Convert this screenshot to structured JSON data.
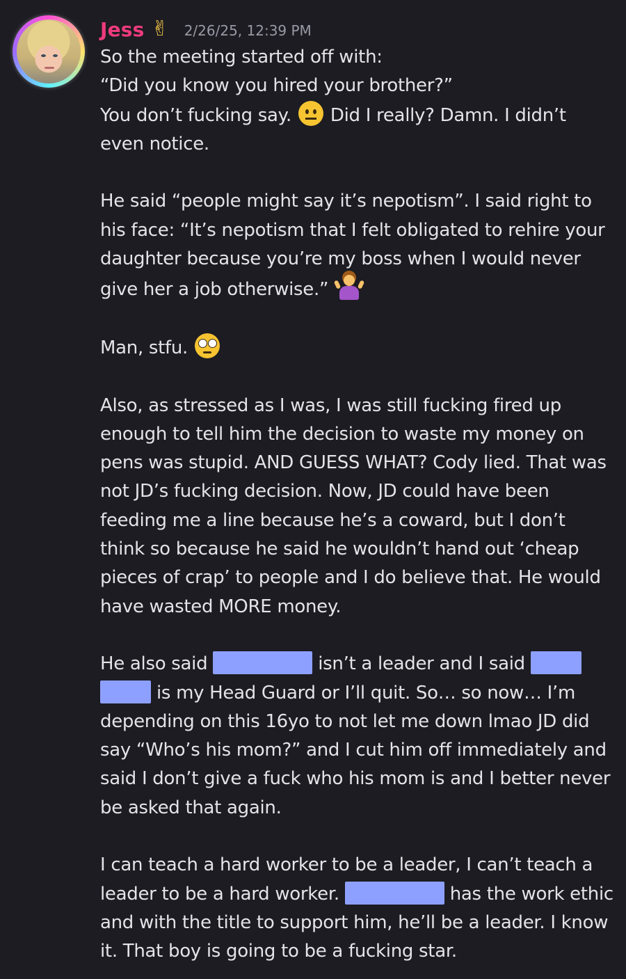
{
  "message": {
    "author": "Jess",
    "role_icon": "victory-hand-emoji",
    "timestamp": "2/26/25, 12:39 PM",
    "avatar_icon": "user-avatar",
    "paragraphs": {
      "p1": {
        "l1": "So the meeting started off with:",
        "l2": "“Did you know you hired your brother?”",
        "l3a": "You don’t fucking say. ",
        "l3b": " Did I really? Damn. I didn’t even notice."
      },
      "p2": {
        "text": "He said “people might say it’s nepotism”. I said right to his face: “It’s nepotism that I felt obligated to rehire your daughter because you’re my boss when I would never give her a job otherwise.” "
      },
      "p3": {
        "text": "Man, stfu. "
      },
      "p4": {
        "text": "Also, as stressed as I was, I was still fucking fired up enough to tell him the decision to waste my money on pens was stupid. AND GUESS WHAT? Cody lied. That was not JD’s fucking decision. Now, JD could have been feeding me a line because he’s a coward, but I don’t think so because he said he wouldn’t hand out ‘cheap pieces of crap’ to people and I do believe that. He would have wasted MORE money."
      },
      "p5": {
        "a": "He also said ",
        "b": " isn’t a leader and I said ",
        "c": " is my Head Guard or I’ll quit. So… so now… I’m depending on this 16yo to not let me down lmao JD did say “Who’s his mom?” and I cut him off immediately and said I don’t give a fuck who his mom is and I better never be asked that again."
      },
      "p6": {
        "a": "I can teach a hard worker to be a leader, I can’t teach a leader to be a hard worker. ",
        "b": " has the work ethic and with the title to support him, he’ll be a leader. I know it. That boy is going to be a fucking star."
      }
    },
    "emojis": {
      "neutral": "neutral-face-emoji",
      "shrug": "person-shrugging-emoji",
      "eyeroll": "face-with-rolling-eyes-emoji"
    }
  },
  "colors": {
    "background": "#1c1c22",
    "username": "#ec3b7c",
    "text": "#e4e4e8",
    "timestamp": "#9a9aa6",
    "redaction": "#8ea0ff"
  }
}
